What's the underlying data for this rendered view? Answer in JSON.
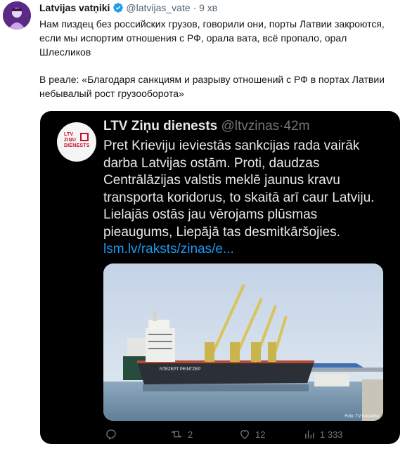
{
  "outer_tweet": {
    "author_name": "Latvijas vatņiki",
    "author_handle": "@latvijas_vate",
    "separator": "·",
    "time": "9 хв",
    "paragraph_1": "Нам пиздец без российских грузов, говорили они, порты Латвии закроются, если мы испортим отношения с РФ, орала вата, всё пропало, орал Шлесликов",
    "paragraph_2": "В реале: «Благодаря санкциям и разрыву отношений с РФ в портах Латвии небывалый рост грузооборота»"
  },
  "embedded_tweet": {
    "avatar_logo_text": "LTV\nZIŅU\nDIENESTS",
    "author_name": "LTV Ziņu dienests",
    "author_handle": "@ltvzinas",
    "separator": "·",
    "time": "42m",
    "body": "Pret Krieviju ieviestās sankcijas rada vairāk darba Latvijas ostām. Proti, daudzas Centrālāzijas valstis meklē jaunus kravu transporta koridorus, to skaitā arī caur Latviju. Lielajās ostās jau vērojams plūsmas pieaugums, Liepājā tas desmitkāršojies.",
    "link": "lsm.lv/raksts/zinas/e...",
    "photo_credit": "Foto: TV Kurzeme",
    "ship_name": "NTEZEPT PEINTZEP",
    "replies_count": "",
    "retweets_count": "2",
    "likes_count": "12",
    "views_count": "1 333"
  },
  "colors": {
    "accent": "#1d9bf0",
    "embed_background": "#000000",
    "embed_text": "#e7e9ea",
    "muted_text": "#536471",
    "brand_red": "#c8102e"
  },
  "icons": [
    "verified-badge-icon",
    "reply-icon",
    "retweet-icon",
    "like-icon",
    "views-icon"
  ]
}
